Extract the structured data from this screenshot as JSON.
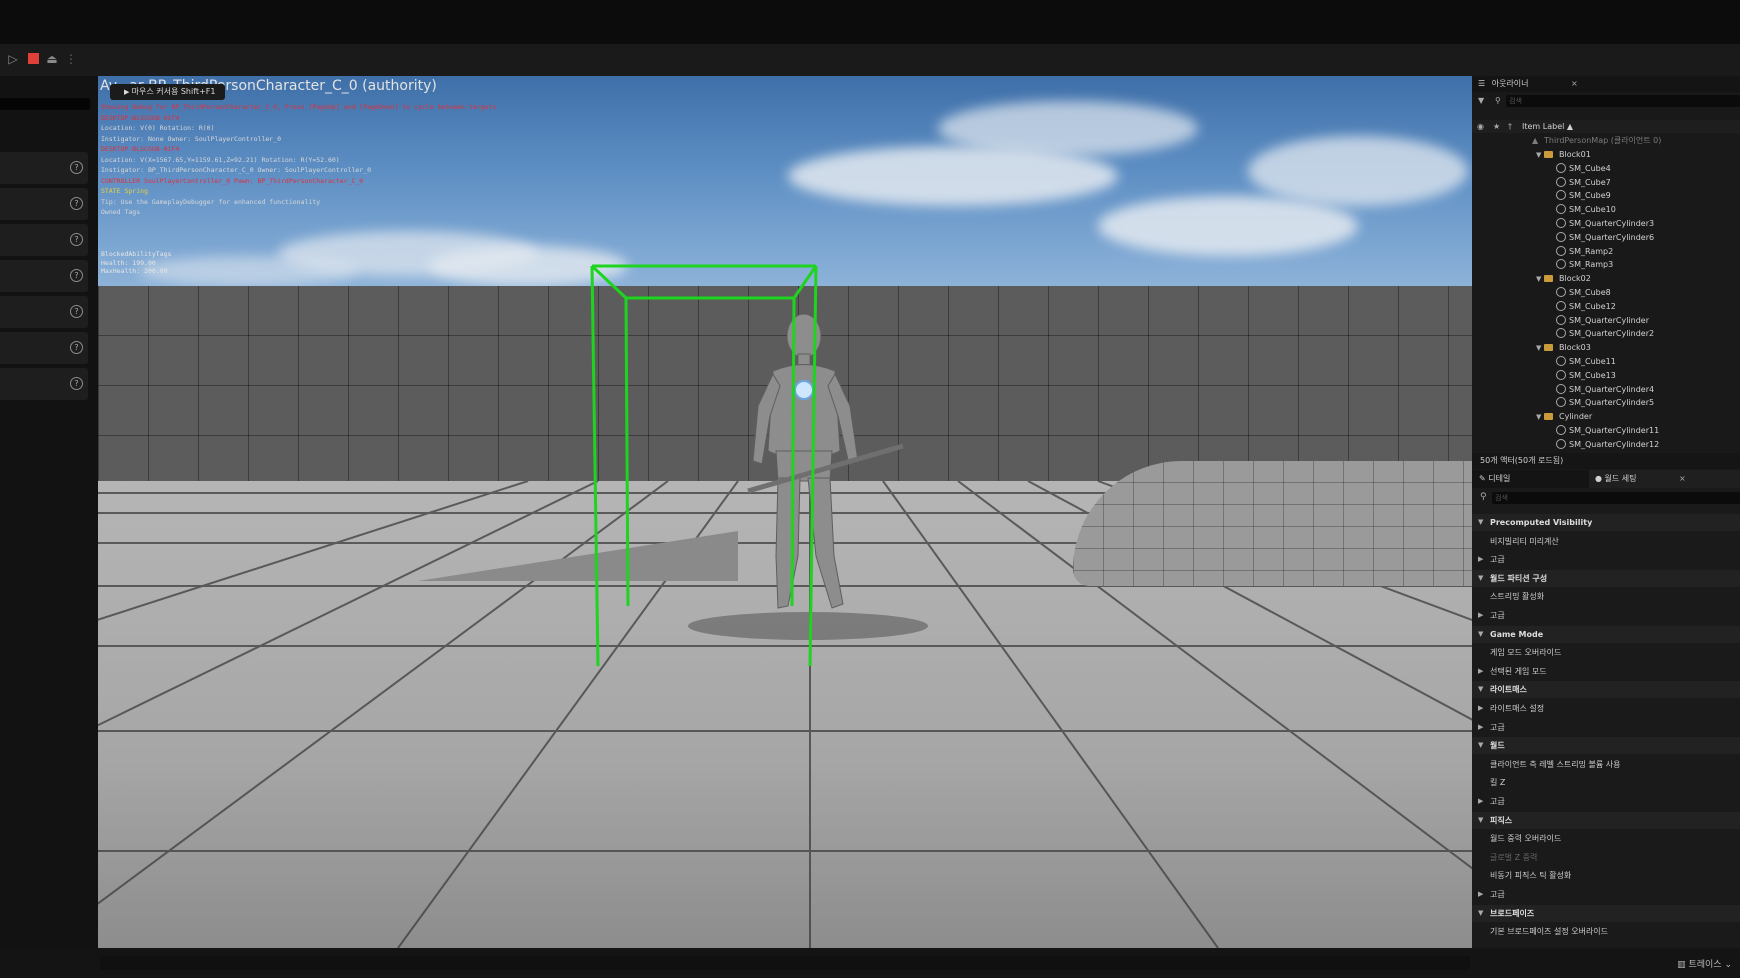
{
  "toolbar": {
    "icons": [
      "play-icon",
      "stop-icon",
      "eject-icon",
      "more-icon"
    ],
    "stop_color": "#e0403a"
  },
  "left_panel": {
    "rows": [
      {
        "icon": "help-icon",
        "glyph": "?"
      },
      {
        "icon": "help-icon",
        "glyph": "?"
      },
      {
        "icon": "help-icon",
        "glyph": "?"
      },
      {
        "icon": "help-icon",
        "glyph": "?"
      },
      {
        "icon": "help-icon",
        "glyph": "?"
      },
      {
        "icon": "help-icon",
        "glyph": "?"
      },
      {
        "icon": "help-icon",
        "glyph": "?"
      }
    ]
  },
  "viewport": {
    "title": "Av...ar BP_ThirdPersonCharacter_C_0 (authority)",
    "cursor_badge": "마우스 커서용 Shift+F1",
    "debug_lines": [
      {
        "text": "Showing Debug for BP_ThirdPersonCharacter_C_0, Press [PageUp] and [PageDown] to cycle between targets",
        "color": "red"
      },
      {
        "text": "DESKTOP-BLSCGU8-01F4",
        "color": "red"
      },
      {
        "text": "Location: V(0) Rotation: R(0)",
        "color": "white"
      },
      {
        "text": "Instigator: None Owner: SoulPlayerController_0",
        "color": "white"
      },
      {
        "text": "DESKTOP-BLSCGU8-01F4",
        "color": "red"
      },
      {
        "text": "Location: V(X=1567.65,Y=1159.61,Z=92.21) Rotation: R(Y=52.60)",
        "color": "white"
      },
      {
        "text": "Instigator: BP_ThirdPersonCharacter_C_0 Owner: SoulPlayerController_0",
        "color": "white"
      },
      {
        "text": "CONTROLLER SoulPlayerController_0 Pawn: BP_ThirdPersonCharacter_C_0",
        "color": "red"
      },
      {
        "text": "STATE Spring",
        "color": "yellow"
      },
      {
        "text": "Tip: Use the GameplayDebugger for enhanced functionality",
        "color": "white"
      },
      {
        "text": "Owned Tags",
        "color": "white"
      }
    ],
    "attributes": {
      "blocked": "BlockedAbilityTags",
      "health": "Health: 199.00",
      "max_health": "MaxHealth: 200.00"
    },
    "collision_box_color": "#1ed41e"
  },
  "outliner": {
    "tab_title": "아웃라이너",
    "search_placeholder": "검색",
    "column_header": "Item Label ▲",
    "map_name": "ThirdPersonMap (클라이언트 0)",
    "items": [
      {
        "label": "Block01",
        "type": "folder"
      },
      {
        "label": "SM_Cube4",
        "type": "mesh"
      },
      {
        "label": "SM_Cube7",
        "type": "mesh"
      },
      {
        "label": "SM_Cube9",
        "type": "mesh"
      },
      {
        "label": "SM_Cube10",
        "type": "mesh"
      },
      {
        "label": "SM_QuarterCylinder3",
        "type": "mesh"
      },
      {
        "label": "SM_QuarterCylinder6",
        "type": "mesh"
      },
      {
        "label": "SM_Ramp2",
        "type": "mesh"
      },
      {
        "label": "SM_Ramp3",
        "type": "mesh"
      },
      {
        "label": "Block02",
        "type": "folder"
      },
      {
        "label": "SM_Cube8",
        "type": "mesh"
      },
      {
        "label": "SM_Cube12",
        "type": "mesh"
      },
      {
        "label": "SM_QuarterCylinder",
        "type": "mesh"
      },
      {
        "label": "SM_QuarterCylinder2",
        "type": "mesh"
      },
      {
        "label": "Block03",
        "type": "folder"
      },
      {
        "label": "SM_Cube11",
        "type": "mesh"
      },
      {
        "label": "SM_Cube13",
        "type": "mesh"
      },
      {
        "label": "SM_QuarterCylinder4",
        "type": "mesh"
      },
      {
        "label": "SM_QuarterCylinder5",
        "type": "mesh"
      },
      {
        "label": "Cylinder",
        "type": "folder"
      },
      {
        "label": "SM_QuarterCylinder11",
        "type": "mesh"
      },
      {
        "label": "SM_QuarterCylinder12",
        "type": "mesh"
      }
    ],
    "status": "50개 액터(50개 로드됨)"
  },
  "details": {
    "tab_details": "디테일",
    "tab_world": "월드 세팅",
    "search_placeholder": "검색",
    "rows": [
      {
        "text": "Precomputed Visibility",
        "kind": "category"
      },
      {
        "text": "비지빌리티 미리계산",
        "kind": "prop"
      },
      {
        "text": "고급",
        "kind": "sub"
      },
      {
        "text": "월드 파티션 구성",
        "kind": "category"
      },
      {
        "text": "스트리밍 활성화",
        "kind": "prop"
      },
      {
        "text": "고급",
        "kind": "sub"
      },
      {
        "text": "Game Mode",
        "kind": "category"
      },
      {
        "text": "게임 모드 오버라이드",
        "kind": "prop"
      },
      {
        "text": "선택된 게임 모드",
        "kind": "sub"
      },
      {
        "text": "라이트매스",
        "kind": "category"
      },
      {
        "text": "라이트매스 설정",
        "kind": "sub"
      },
      {
        "text": "고급",
        "kind": "sub"
      },
      {
        "text": "월드",
        "kind": "category"
      },
      {
        "text": "클라이언트 측 레벨 스트리밍 볼륨 사용",
        "kind": "prop"
      },
      {
        "text": "킬 Z",
        "kind": "prop"
      },
      {
        "text": "고급",
        "kind": "sub"
      },
      {
        "text": "피직스",
        "kind": "category"
      },
      {
        "text": "월드 중력 오버라이드",
        "kind": "prop"
      },
      {
        "text": "글로벌 Z 중력",
        "kind": "prop-dim"
      },
      {
        "text": "비동기 피직스 틱 활성화",
        "kind": "prop"
      },
      {
        "text": "고급",
        "kind": "sub"
      },
      {
        "text": "브로드페이즈",
        "kind": "category"
      },
      {
        "text": "기본 브로드페이즈 설정 오버라이드",
        "kind": "prop"
      }
    ]
  },
  "status_bar": {
    "right_label": "트레이스"
  }
}
